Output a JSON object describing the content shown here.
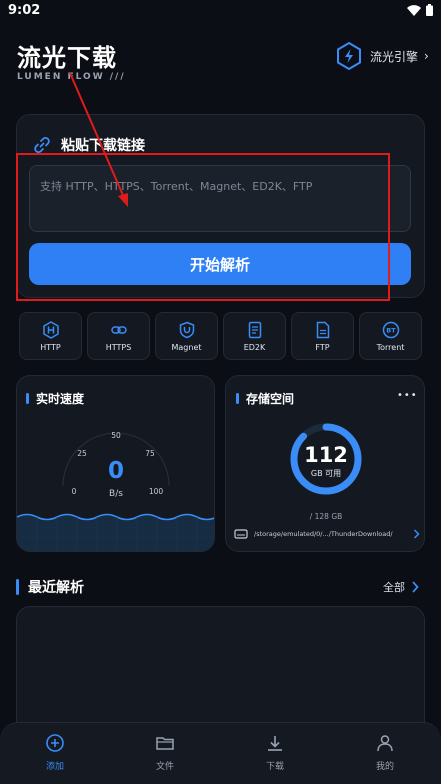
{
  "status_bar": {
    "time": "9:02"
  },
  "header": {
    "title": "流光下载",
    "subtitle": "LUMEN FLOW  ///",
    "engine_label": "流光引擎",
    "engine_chevron": "›"
  },
  "paste": {
    "title": "粘贴下载链接",
    "placeholder": "支持 HTTP、HTTPS、Torrent、Magnet、ED2K、FTP",
    "parse_button": "开始解析"
  },
  "protocols": [
    {
      "label": "HTTP",
      "icon": "http-icon"
    },
    {
      "label": "HTTPS",
      "icon": "link-icon"
    },
    {
      "label": "Magnet",
      "icon": "magnet-icon"
    },
    {
      "label": "ED2K",
      "icon": "document-icon"
    },
    {
      "label": "FTP",
      "icon": "file-icon"
    },
    {
      "label": "Torrent",
      "icon": "bt-icon"
    }
  ],
  "speed": {
    "title": "实时速度",
    "value": "0",
    "unit": "B/s",
    "ticks": [
      "0",
      "25",
      "50",
      "75",
      "100"
    ]
  },
  "storage": {
    "title": "存储空间",
    "menu": "•••",
    "free_value": "112",
    "free_label": "GB 可用",
    "total": "/ 128 GB",
    "used_fraction": 0.125,
    "path": "/storage/emulated/0/.../ThunderDownload/"
  },
  "recent": {
    "title": "最近解析",
    "see_all": "全部"
  },
  "nav": [
    {
      "label": "添加",
      "active": true
    },
    {
      "label": "文件",
      "active": false
    },
    {
      "label": "下载",
      "active": false
    },
    {
      "label": "我的",
      "active": false
    }
  ],
  "colors": {
    "accent": "#2f80f5",
    "background": "#0b0e14",
    "card": "#131821",
    "highlight": "#e01b1b"
  }
}
